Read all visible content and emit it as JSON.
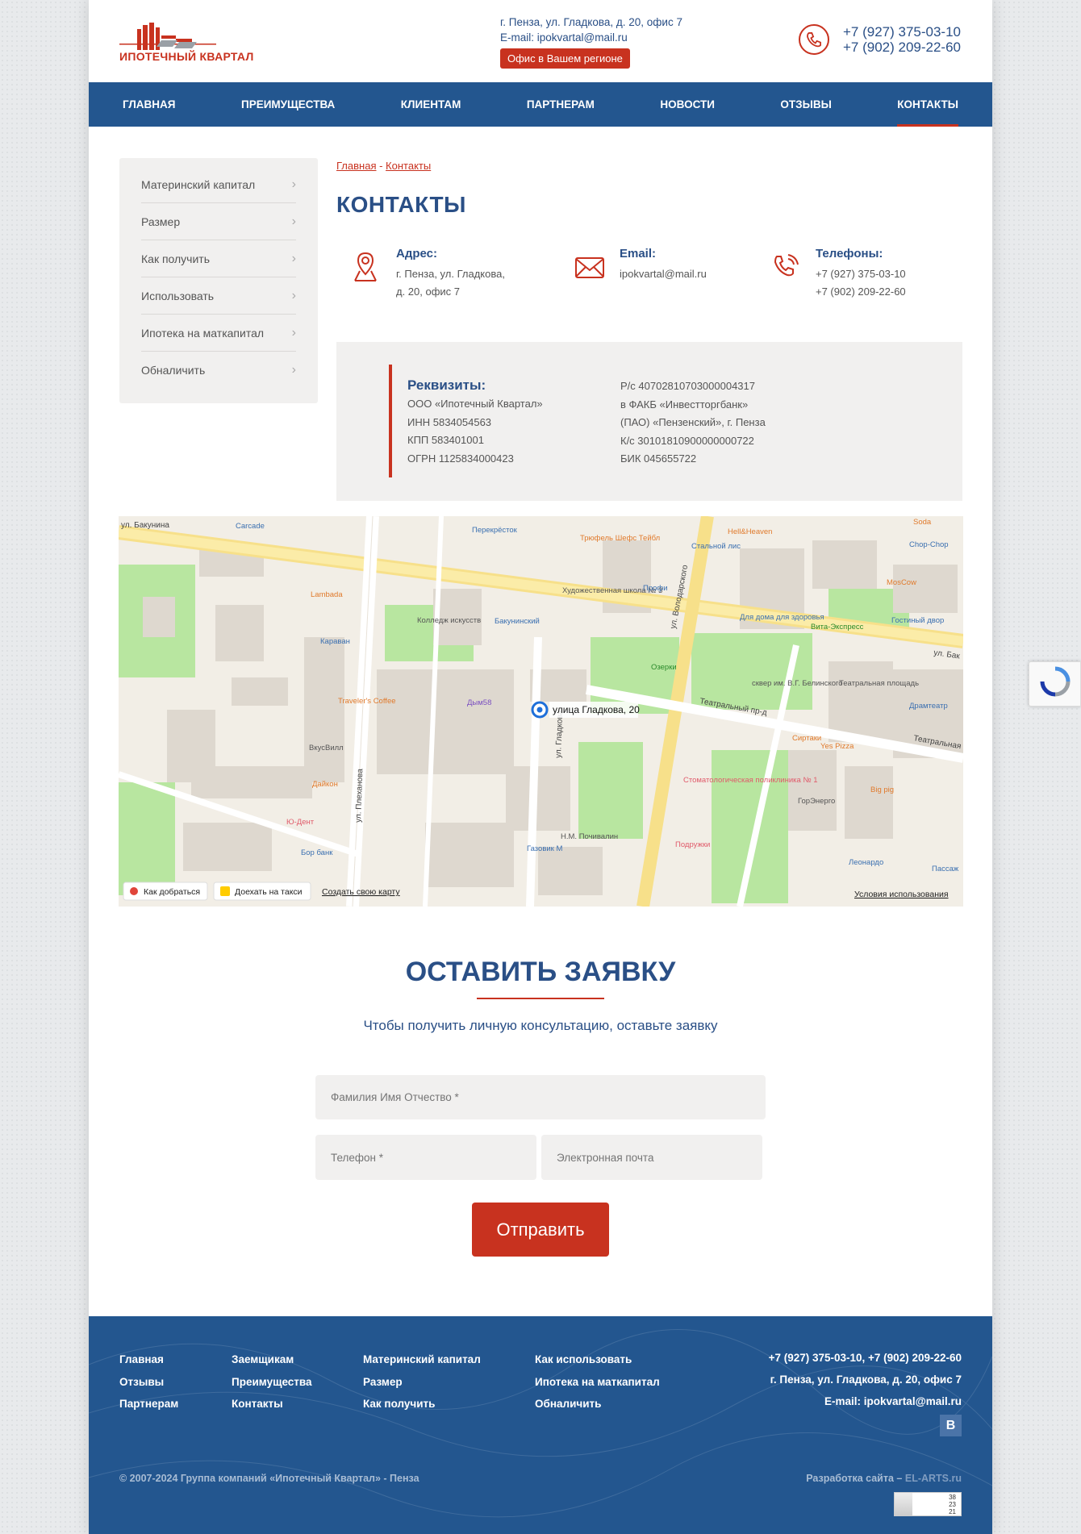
{
  "header": {
    "logo_text": "ИПОТЕЧНЫЙ КВАРТАЛ",
    "address": "г. Пенза, ул. Гладкова, д. 20, офис 7",
    "email_line": "E-mail: ipokvartal@mail.ru",
    "office_button": "Офис в Вашем регионе",
    "phone1": "+7 (927) 375-03-10",
    "phone2": "+7 (902) 209-22-60"
  },
  "nav": {
    "items": [
      "ГЛАВНАЯ",
      "ПРЕИМУЩЕСТВА",
      "КЛИЕНТАМ",
      "ПАРТНЕРАМ",
      "НОВОСТИ",
      "ОТЗЫВЫ",
      "КОНТАКТЫ"
    ],
    "active": "КОНТАКТЫ"
  },
  "sidebar": {
    "items": [
      "Материнский капитал",
      "Размер",
      "Как получить",
      "Использовать",
      "Ипотека на маткапитал",
      "Обналичить"
    ]
  },
  "breadcrumb": {
    "home": "Главная",
    "sep": " - ",
    "current": "Контакты"
  },
  "page_title": "КОНТАКТЫ",
  "contacts": {
    "address_label": "Адрес:",
    "address_line1": "г. Пенза, ул. Гладкова,",
    "address_line2": "д. 20, офис 7",
    "email_label": "Email:",
    "email": "ipokvartal@mail.ru",
    "phones_label": "Телефоны:",
    "phone1": "+7 (927) 375-03-10",
    "phone2": "+7 (902) 209-22-60"
  },
  "requisites": {
    "title": "Реквизиты:",
    "left": [
      "ООО «Ипотечный Квартал»",
      "ИНН 5834054563",
      "КПП 583401001",
      "ОГРН 1125834000423"
    ],
    "right": [
      "Р/с 40702810703000004317",
      "в ФАКБ «Инвестторгбанк»",
      "(ПАО) «Пензенский», г. Пенза",
      "К/с 30101810900000000722",
      "БИК 045655722"
    ]
  },
  "map": {
    "marker_label": "улица Гладкова, 20",
    "route_button": "Как добраться",
    "taxi_button": "Доехать на такси",
    "create_map_link": "Создать свою карту",
    "terms_link": "Условия использования",
    "streets": [
      "ул. Бакунина",
      "ул. Плеханова",
      "ул. Володарского",
      "ул. Гладкова",
      "Театральный пр-д",
      "Театральная",
      "ул. Бак"
    ],
    "places": [
      "Carcade",
      "Перекрёсток",
      "Трюфель Шефс Тейбл",
      "Hell&Heaven",
      "Стальной лис",
      "Soda",
      "Chop-Chop",
      "Lambada",
      "Колледж искусств",
      "Бакунинский",
      "Художественная школа № 3",
      "Профи",
      "Для дома для здоровья",
      "Вита-Экспресс",
      "Гостиный двор",
      "MosCow",
      "Караван",
      "Озерки",
      "сквер им. В.Г. Белинского",
      "Театральная площадь",
      "Драмтеатр",
      "Дым58",
      "Traveler's Coffee",
      "ВкусВилл",
      "Дайкон",
      "Сиртаки",
      "Yes Pizza",
      "Стоматологическая поликлиника № 1",
      "ГорЭнерго",
      "Big pig",
      "Ю-Дент",
      "Бор банк",
      "Газовик М",
      "Н.М. Почивалин",
      "Подружки",
      "Леонардо",
      "Пассаж"
    ]
  },
  "form": {
    "title": "ОСТАВИТЬ ЗАЯВКУ",
    "subtitle": "Чтобы получить личную консультацию, оставьте заявку",
    "name_placeholder": "Фамилия Имя Отчество *",
    "phone_placeholder": "Телефон *",
    "email_placeholder": "Электронная почта",
    "submit": "Отправить"
  },
  "footer": {
    "col1": [
      "Главная",
      "Отзывы",
      "Партнерам"
    ],
    "col2": [
      "Заемщикам",
      "Преимущества",
      "Контакты"
    ],
    "col3": [
      "Материнский капитал",
      "Размер",
      "Как получить"
    ],
    "col4": [
      "Как использовать",
      "Ипотека на маткапитал",
      "Обналичить"
    ],
    "phones": "+7 (927) 375-03-10, +7 (902) 209-22-60",
    "address": "г. Пенза, ул. Гладкова, д. 20, офис 7",
    "email": "E-mail: ipokvartal@mail.ru",
    "vk": "В",
    "copyright": "© 2007-2024 Группа компаний «Ипотечный Квартал» - Пенза",
    "dev_label": "Разработка сайта –",
    "dev_name": "EL-ARTS.ru",
    "counter": [
      "38",
      "23",
      "21"
    ]
  },
  "colors": {
    "primary": "#23568f",
    "accent": "#c8321f",
    "heading": "#2a4f86"
  }
}
